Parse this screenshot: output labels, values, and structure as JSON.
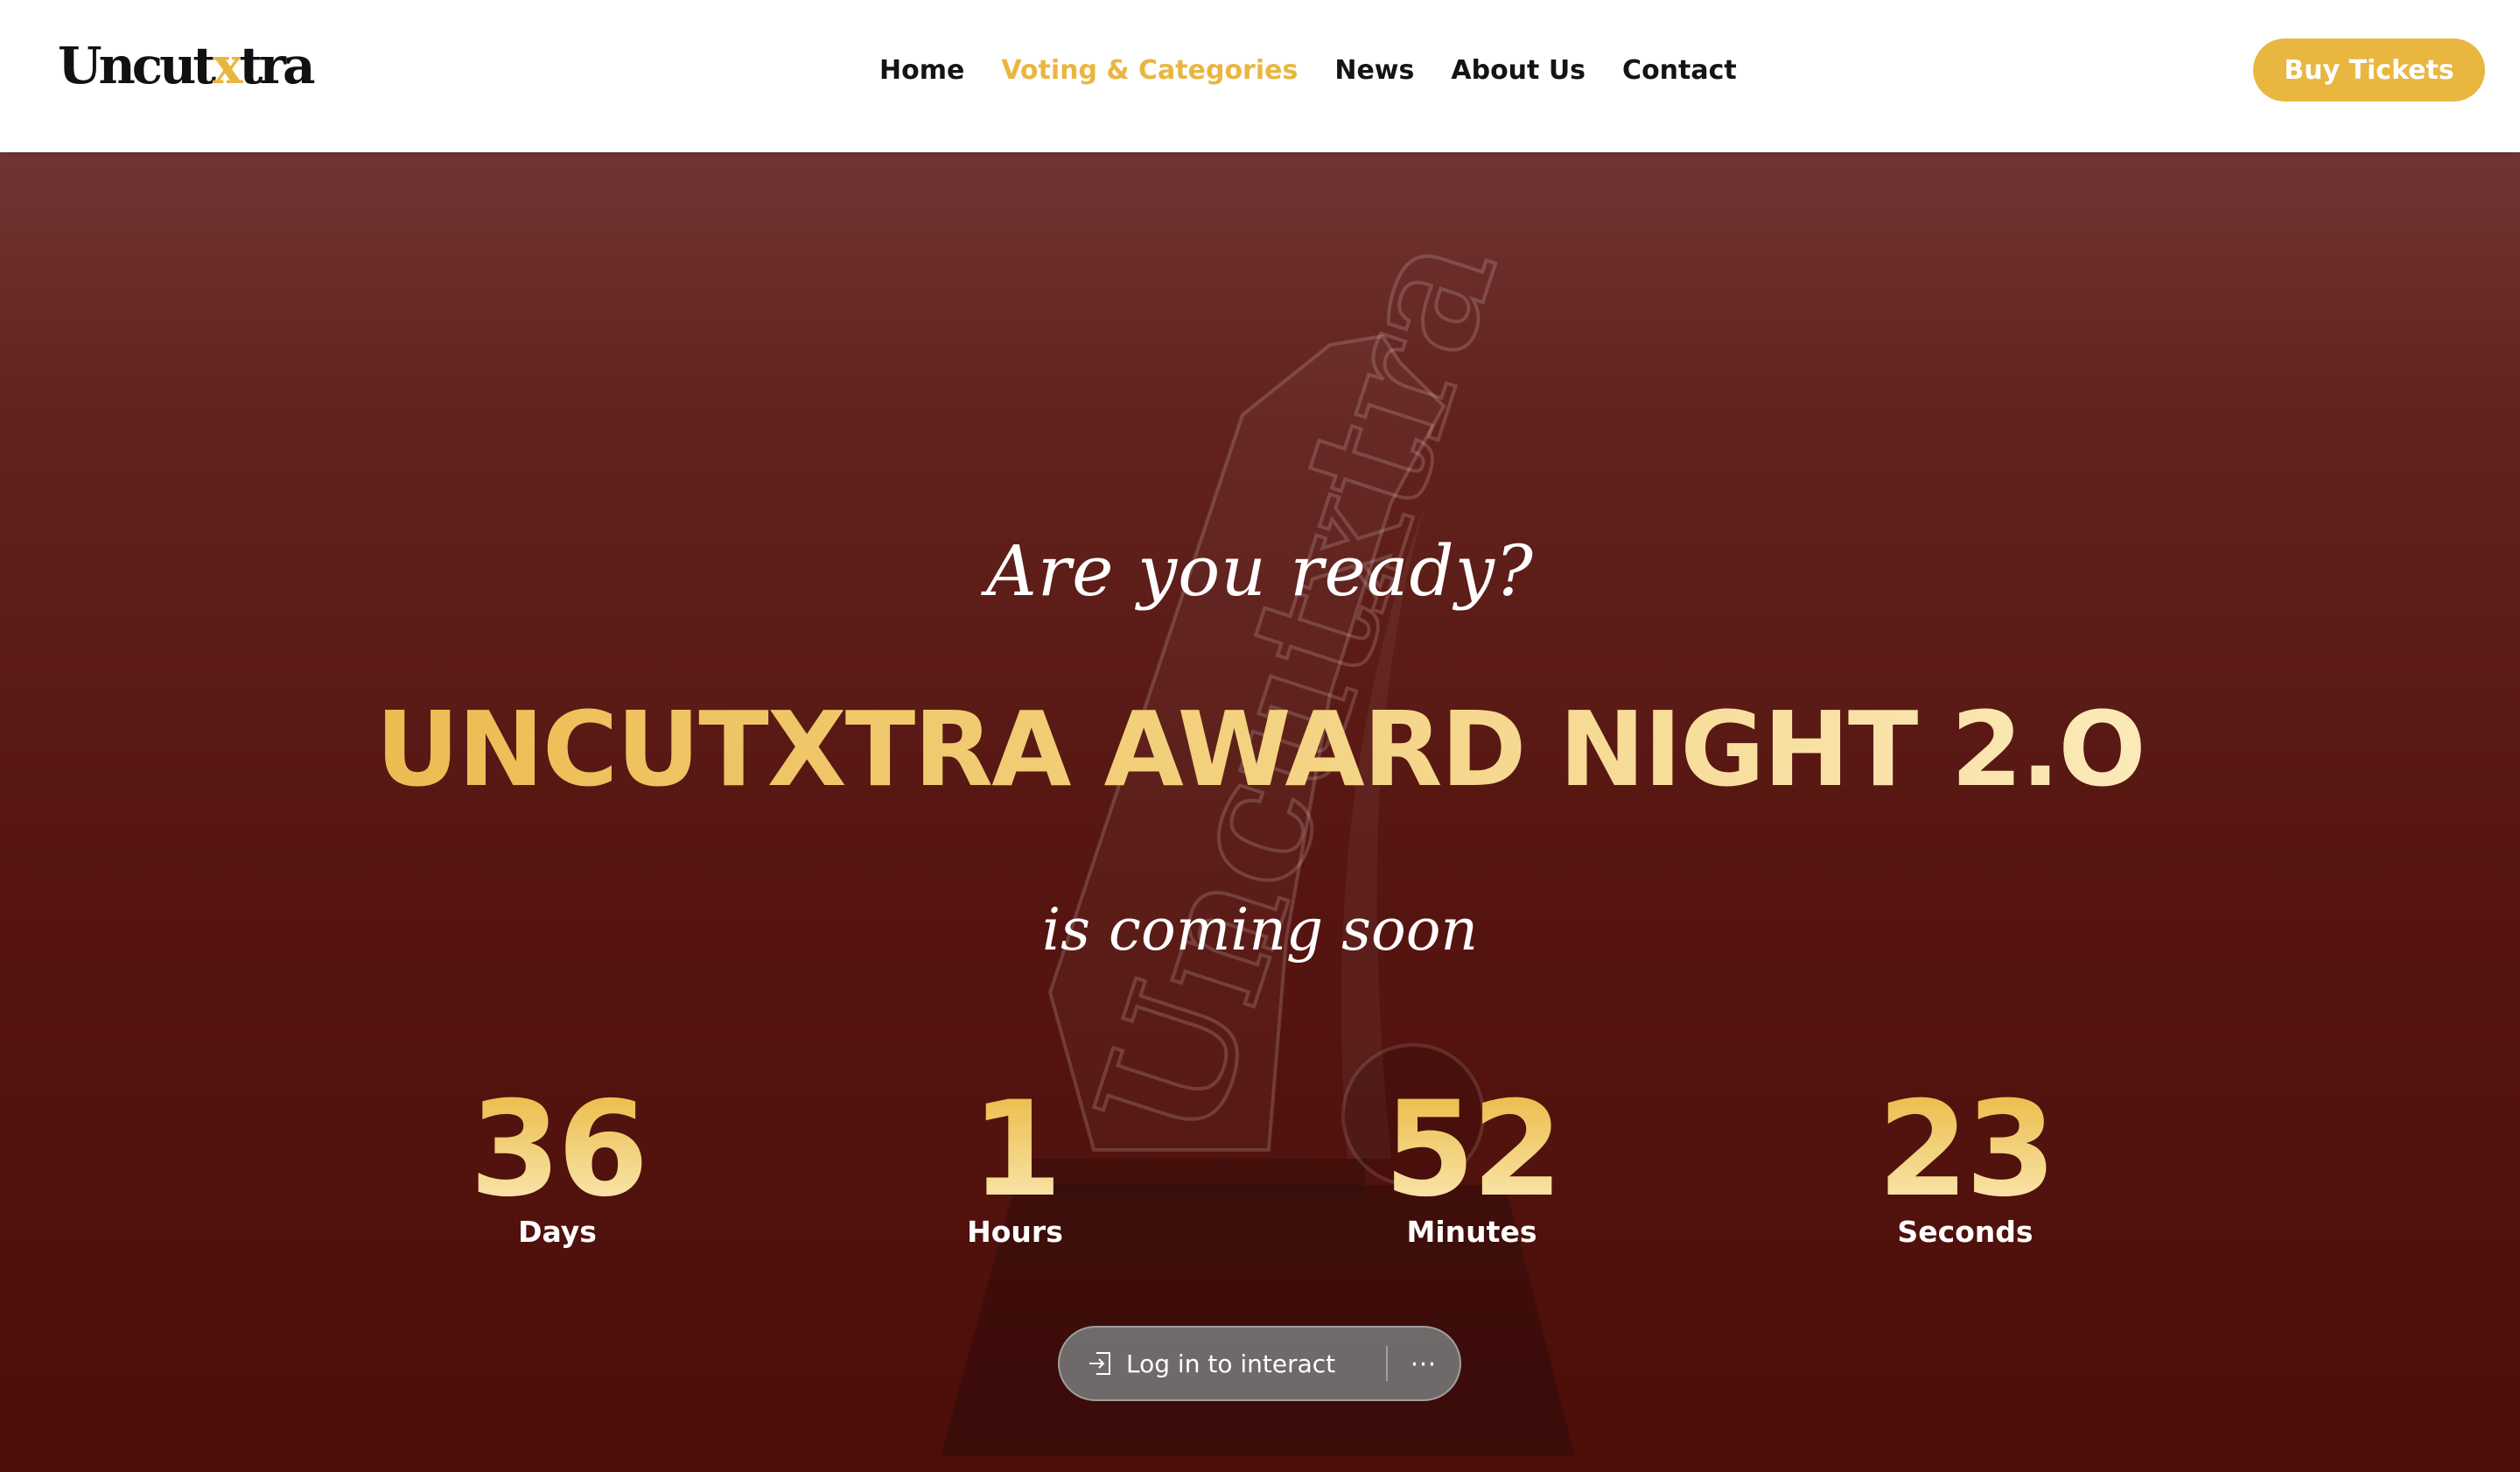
{
  "brand": {
    "logo_prefix": "Uncut",
    "logo_accent": "x",
    "logo_suffix": "tra",
    "accent_color": "#e9b640"
  },
  "nav": {
    "items": [
      {
        "label": "Home",
        "active": false
      },
      {
        "label": "Voting & Categories",
        "active": true
      },
      {
        "label": "News",
        "active": false
      },
      {
        "label": "About Us",
        "active": false
      },
      {
        "label": "Contact",
        "active": false
      }
    ],
    "cta_label": "Buy Tickets"
  },
  "hero": {
    "tagline_top": "Are you ready?",
    "title": "UNCUTXTRA AWARD NIGHT 2.O",
    "tagline_bottom": "is coming soon",
    "trophy_text": "Uncutxtra",
    "countdown": [
      {
        "value": "36",
        "label": "Days"
      },
      {
        "value": "1",
        "label": "Hours"
      },
      {
        "value": "52",
        "label": "Minutes"
      },
      {
        "value": "23",
        "label": "Seconds"
      }
    ]
  },
  "login_bar": {
    "label": "Log in to interact",
    "icon": "login-arrow-icon",
    "more_icon": "more-icon"
  }
}
